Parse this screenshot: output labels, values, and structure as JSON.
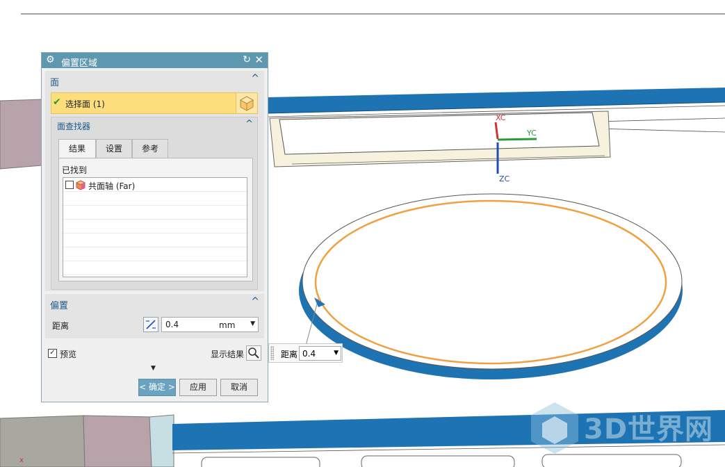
{
  "dialog": {
    "title": "偏置区域",
    "face_group": {
      "header": "面",
      "select_face_label": "选择面 (1)",
      "finder": {
        "header": "面查找器",
        "tabs": [
          {
            "label": "结果",
            "active": true
          },
          {
            "label": "设置",
            "active": false
          },
          {
            "label": "参考",
            "active": false
          }
        ],
        "found_label": "已找到",
        "results": [
          {
            "label": "共面轴 (Far)",
            "checked": false
          }
        ]
      }
    },
    "offset_group": {
      "header": "偏置",
      "distance_label": "距离",
      "distance_value": "0.4",
      "distance_unit": "mm"
    },
    "preview": {
      "label": "预览",
      "checked": true,
      "show_result_label": "显示结果"
    },
    "buttons": {
      "ok": "< 确定 >",
      "apply": "应用",
      "cancel": "取消"
    }
  },
  "floating_input": {
    "label": "距离",
    "value": "0.4"
  },
  "axes": {
    "xc": "XC",
    "yc": "YC",
    "zc": "ZC"
  },
  "watermark": {
    "text": "3D世界网"
  },
  "colors": {
    "title_bar": "#5e97b0",
    "selection_highlight": "#fcde7d",
    "model_blue": "#1e73b3",
    "orange_offset": "#f0a040",
    "group_header_text": "#1d5a8a"
  }
}
